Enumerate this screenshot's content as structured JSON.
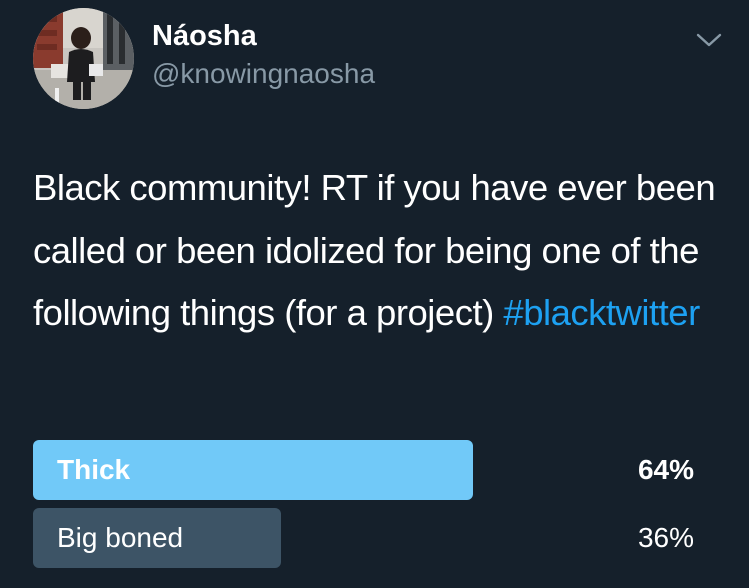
{
  "author": {
    "display_name": "Náosha",
    "handle": "@knowingnaosha"
  },
  "tweet": {
    "text_before_hashtag": "Black community! RT if you have ever been called or been idolized for being one of the following things (for a project)",
    "hashtag": "#blacktwitter"
  },
  "poll": {
    "options": [
      {
        "label": "Thick",
        "percent_text": "64%",
        "percent": 64,
        "bar_color": "#71c9f8"
      },
      {
        "label": "Big boned",
        "percent_text": "36%",
        "percent": 36,
        "bar_color": "#3d5466"
      }
    ]
  },
  "icons": {
    "menu": "chevron-down-icon",
    "avatar": "profile-photo"
  },
  "colors": {
    "background": "#15202b",
    "hashtag": "#1da1f2",
    "secondary_text": "#8899a6"
  }
}
